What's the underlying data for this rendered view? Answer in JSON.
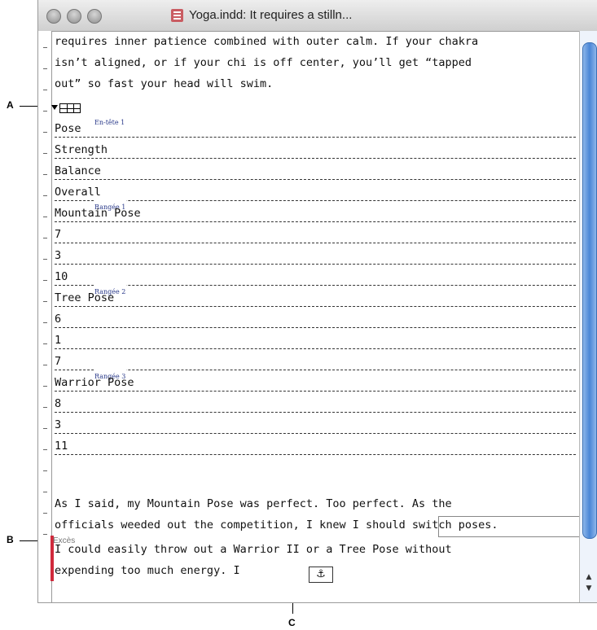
{
  "callouts": {
    "a": "A",
    "b": "B",
    "c": "C"
  },
  "window": {
    "title": "Yoga.indd: It requires a stilln..."
  },
  "story": {
    "intro_lines": [
      "requires inner patience combined with outer calm. If your chakra",
      "isn’t aligned, or if your chi is off center, you’ll get “tapped",
      "out” so fast your head will swim."
    ],
    "table": {
      "header_tag": "En-tête 1",
      "header_cells": [
        "Pose",
        "Strength",
        "Balance",
        "Overall"
      ],
      "rows": [
        {
          "tag": "Rangée 1",
          "cells": [
            "Mountain Pose",
            "7",
            "3",
            "10"
          ]
        },
        {
          "tag": "Rangée 2",
          "cells": [
            "Tree Pose",
            "6",
            "1",
            "7"
          ]
        },
        {
          "tag": "Rangée 3",
          "cells": [
            "Warrior Pose",
            "8",
            "3",
            "11"
          ]
        }
      ]
    },
    "closing_lines": [
      "As I said, my Mountain Pose was perfect. Too perfect. As the",
      "officials weeded out the competition, I knew I should switch poses.",
      "I could easily throw out a Warrior II or a Tree Pose without",
      "expending too much energy. I "
    ],
    "overset_label": "Excès",
    "anchor_glyph": "⚓"
  },
  "icons": [
    "close-light-icon",
    "minimize-light-icon",
    "zoom-light-icon",
    "indesign-document-icon",
    "table-icon",
    "anchor-icon",
    "scroll-up-icon",
    "scroll-down-icon"
  ],
  "colors": {
    "overset_bar": "#d02a3c",
    "tag_text": "#2a3a8a",
    "scroll_thumb": "#4a86d6"
  }
}
